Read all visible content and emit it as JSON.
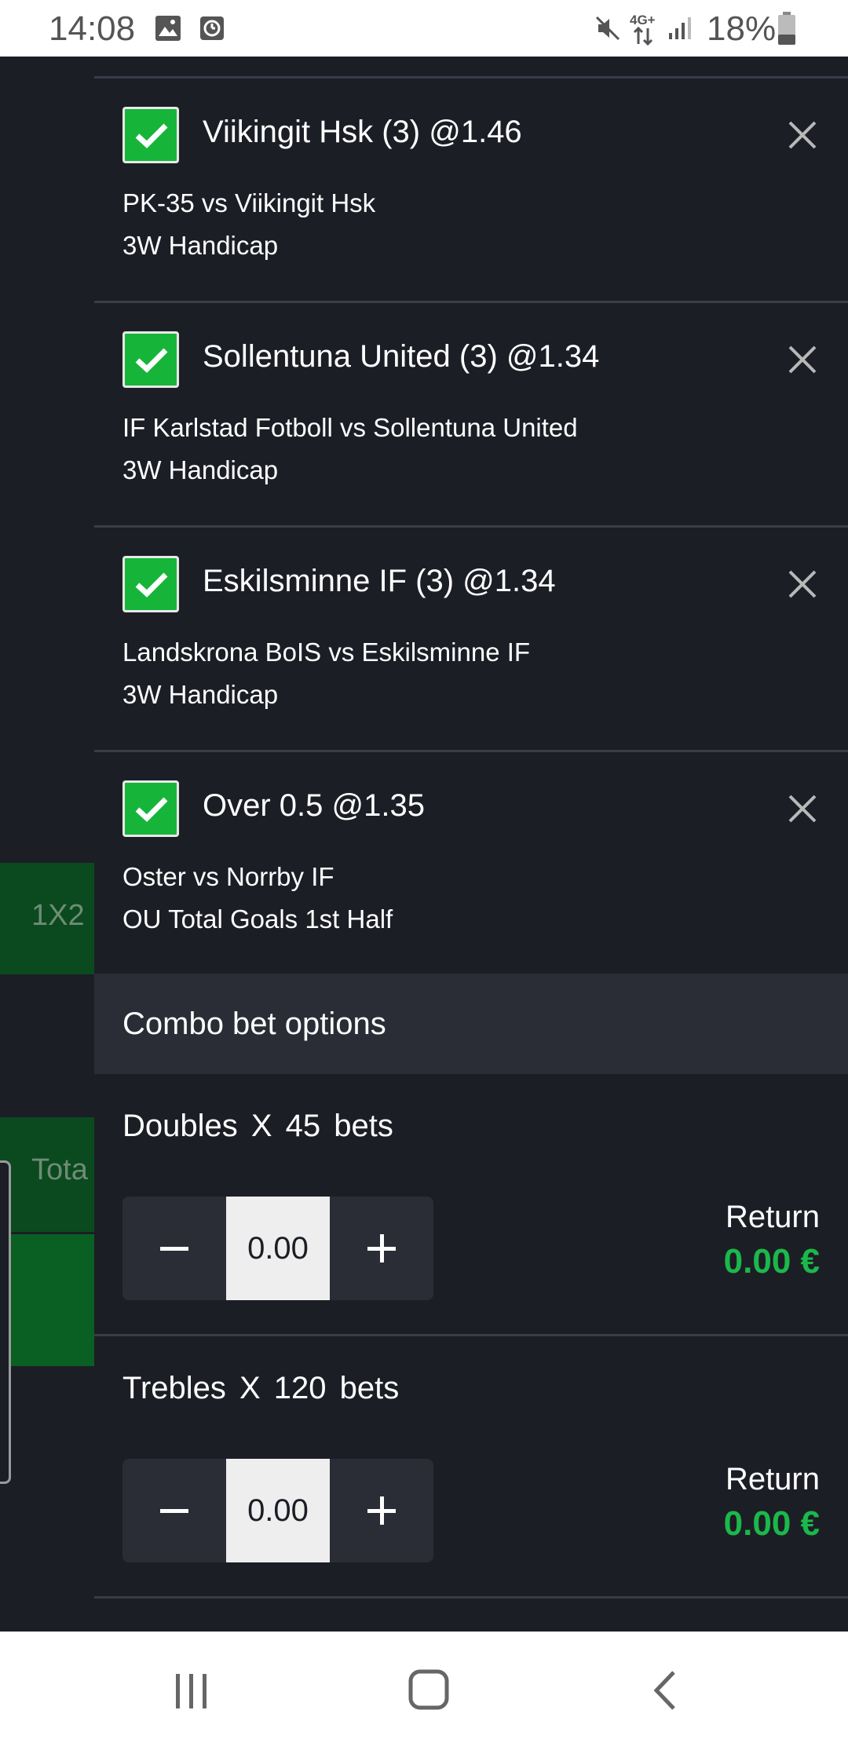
{
  "status_bar": {
    "time": "14:08",
    "network": "4G+",
    "battery": "18%",
    "icons": [
      "image-icon",
      "alarm-icon",
      "mute-icon",
      "data-arrows-icon",
      "signal-icon",
      "battery-icon"
    ]
  },
  "background_page": {
    "tab_1x2": "1X2",
    "tab_total": "Tota"
  },
  "bets": [
    {
      "title": "Viikingit Hsk (3) @1.46",
      "match": "PK-35 vs Viikingit Hsk",
      "market": "3W Handicap",
      "checked": true
    },
    {
      "title": "Sollentuna United (3) @1.34",
      "match": "IF Karlstad Fotboll vs Sollentuna United",
      "market": "3W Handicap",
      "checked": true
    },
    {
      "title": "Eskilsminne IF (3) @1.34",
      "match": "Landskrona BoIS vs Eskilsminne IF",
      "market": "3W Handicap",
      "checked": true
    },
    {
      "title": "Over 0.5 @1.35",
      "match": "Oster vs Norrby IF",
      "market": "OU Total Goals 1st Half",
      "checked": true
    }
  ],
  "combo": {
    "header": "Combo bet options",
    "rows": [
      {
        "label": "Doubles X 45 bets",
        "stake": "0.00",
        "return_label": "Return",
        "return_value": "0.00 €"
      },
      {
        "label": "Trebles X 120 bets",
        "stake": "0.00",
        "return_label": "Return",
        "return_value": "0.00 €"
      }
    ]
  },
  "colors": {
    "background": "#1c1e26",
    "accent_green": "#16b53a",
    "return_green": "#1bb84a",
    "header_bg": "#2a2d36"
  }
}
